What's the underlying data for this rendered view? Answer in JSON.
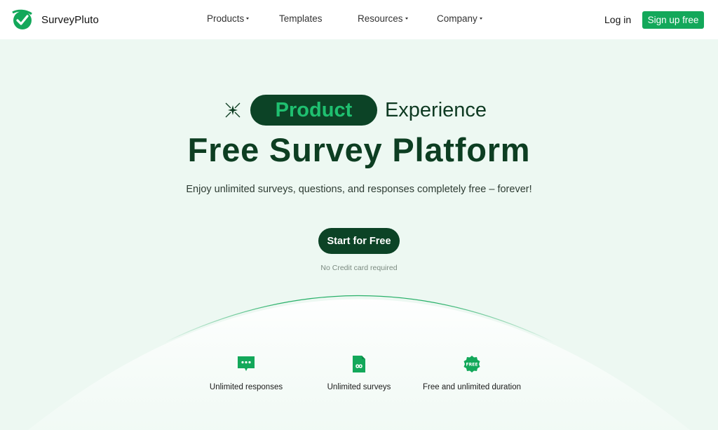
{
  "nav": {
    "brand": "SurveyPluto",
    "items": [
      {
        "label": "Products",
        "dropdown": true
      },
      {
        "label": "Templates",
        "dropdown": false
      },
      {
        "label": "Resources",
        "dropdown": true
      },
      {
        "label": "Company",
        "dropdown": true
      }
    ],
    "login": "Log in",
    "signup": "Sign up free"
  },
  "hero": {
    "pill": "Product",
    "experience": "Experience",
    "title": "Free Survey Platform",
    "subtitle": "Enjoy unlimited surveys, questions, and responses completely free – forever!",
    "cta": "Start for Free",
    "note": "No Credit card required"
  },
  "features": [
    {
      "icon": "chat-bubble-icon",
      "label": "Unlimited responses"
    },
    {
      "icon": "infinity-document-icon",
      "label": "Unlimited surveys"
    },
    {
      "icon": "free-badge-icon",
      "label": "Free and unlimited duration",
      "badge_text": "FREE"
    }
  ],
  "colors": {
    "brand_green": "#13a85a",
    "dark_green": "#0c4326",
    "background": "#edf8f2"
  }
}
